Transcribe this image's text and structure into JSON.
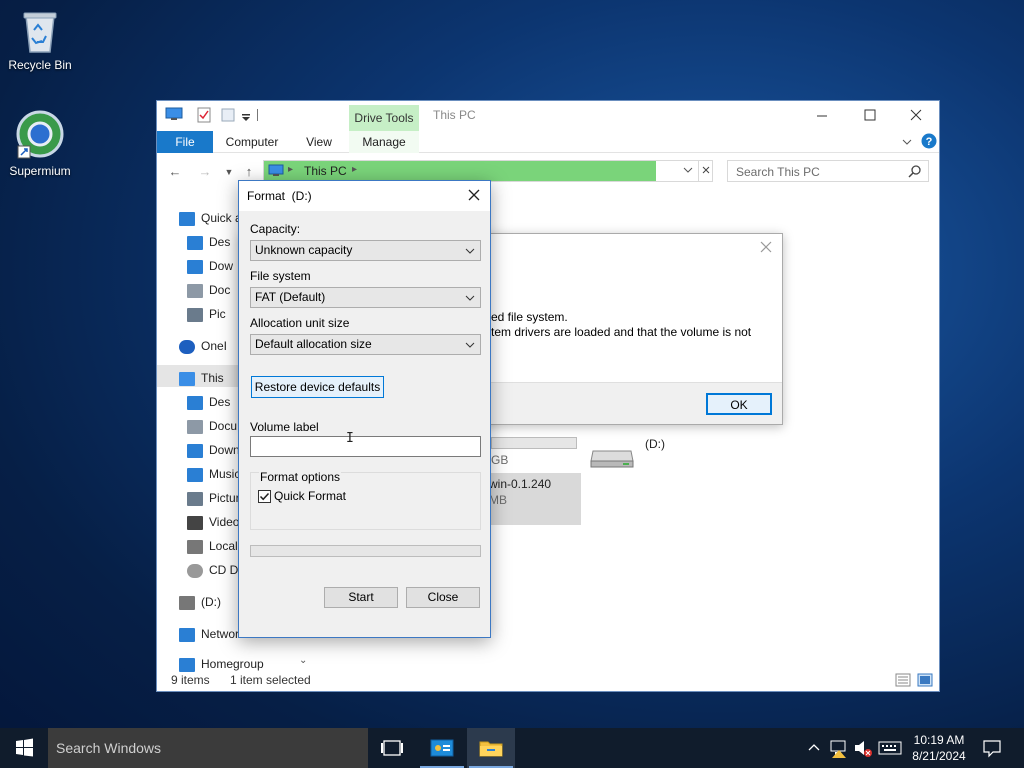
{
  "desktop": {
    "icons": [
      {
        "label": "Recycle Bin"
      },
      {
        "label": "Supermium"
      }
    ]
  },
  "explorer": {
    "window_title": "This PC",
    "contextual_tab_group": "Drive Tools",
    "tabs": [
      "File",
      "Computer",
      "View",
      "Manage"
    ],
    "address": "This PC",
    "search_placeholder": "Search This PC",
    "nav_items": [
      {
        "label": "Quick a",
        "icon": "star-icon"
      },
      {
        "label": "Des",
        "icon": "desktop-icon"
      },
      {
        "label": "Dow",
        "icon": "download-icon"
      },
      {
        "label": "Doc",
        "icon": "document-icon"
      },
      {
        "label": "Pic",
        "icon": "picture-icon"
      },
      {
        "label": "OneI",
        "icon": "cloud-icon"
      },
      {
        "label": "This",
        "icon": "computer-icon"
      },
      {
        "label": "Des",
        "icon": "desktop-icon"
      },
      {
        "label": "Docu",
        "icon": "document-icon"
      },
      {
        "label": "Down",
        "icon": "download-icon"
      },
      {
        "label": "Music",
        "icon": "music-icon"
      },
      {
        "label": "Pictur",
        "icon": "picture-icon"
      },
      {
        "label": "Video",
        "icon": "video-icon"
      },
      {
        "label": "Local",
        "icon": "drive-icon"
      },
      {
        "label": "CD Dr",
        "icon": "cd-icon"
      },
      {
        "label": "(D:)",
        "icon": "drive-icon"
      },
      {
        "label": "Networ",
        "icon": "network-icon"
      },
      {
        "label": "Homegroup",
        "icon": "homegroup-icon"
      }
    ],
    "content": {
      "drive_gb_fragment": "GB",
      "cd_label_fragment": "win-0.1.240",
      "cd_size_fragment": "MB",
      "d_drive_label": "(D:)"
    },
    "status": {
      "items": "9 items",
      "selected": "1 item selected"
    }
  },
  "error_dialog": {
    "line1": "ed file system.",
    "line2": "tem drivers are loaded and that the volume is not",
    "ok_label": "OK"
  },
  "format_dialog": {
    "title": "Format  (D:)",
    "capacity_label": "Capacity:",
    "capacity_value": "Unknown capacity",
    "fs_label": "File system",
    "fs_value": "FAT (Default)",
    "alloc_label": "Allocation unit size",
    "alloc_value": "Default allocation size",
    "restore_label": "Restore device defaults",
    "volume_label": "Volume label",
    "volume_value": "",
    "options_label": "Format options",
    "quick_format_label": "Quick Format",
    "quick_format_checked": true,
    "progress": 0,
    "start_label": "Start",
    "close_label": "Close"
  },
  "taskbar": {
    "search_placeholder": "Search Windows",
    "time": "10:19 AM",
    "date": "8/21/2024"
  }
}
